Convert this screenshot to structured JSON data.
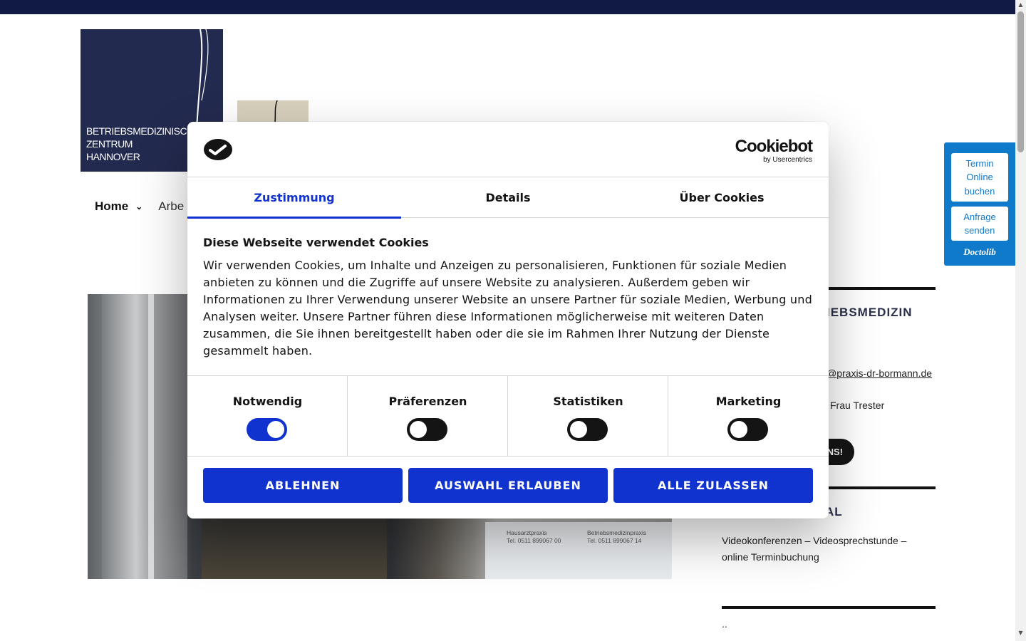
{
  "logo": {
    "lines": [
      "BETRIEBSMEDIZINISCHES",
      "ZENTRUM",
      "HANNOVER"
    ]
  },
  "nav": {
    "home_label": "Home",
    "second_label_partial": "Arbe"
  },
  "hero": {
    "sign_left": [
      "Hausarztpraxis",
      "Tel. 0511 899067 00"
    ],
    "sign_right": [
      "Betriebsmedizinpraxis",
      "Tel. 0511 899067 14"
    ]
  },
  "sidebar": {
    "section1_heading_visible": "IEBSMEDIZIN",
    "email_visible": "@praxis-dr-bormann.de",
    "contact_visible": "Frau Trester",
    "button_visible": "NS!",
    "section2_heading_visible": "AL",
    "section2_text": "Videokonferenzen – Videosprechstunde – online Terminbuchung",
    "section3_text": ".."
  },
  "doctolib": {
    "book_label": "Termin Online buchen",
    "request_label": "Anfrage senden",
    "brand": "Doctolib"
  },
  "cookie_dialog": {
    "brand_name": "Cookiebot",
    "brand_by": "by Usercentrics",
    "tabs": [
      {
        "label": "Zustimmung",
        "active": true
      },
      {
        "label": "Details",
        "active": false
      },
      {
        "label": "Über Cookies",
        "active": false
      }
    ],
    "title": "Diese Webseite verwendet Cookies",
    "body": "Wir verwenden Cookies, um Inhalte und Anzeigen zu personalisieren, Funktionen für soziale Medien anbieten zu können und die Zugriffe auf unsere Website zu analysieren. Außerdem geben wir Informationen zu Ihrer Verwendung unserer Website an unsere Partner für soziale Medien, Werbung und Analysen weiter. Unsere Partner führen diese Informationen möglicherweise mit weiteren Daten zusammen, die Sie ihnen bereitgestellt haben oder die sie im Rahmen Ihrer Nutzung der Dienste gesammelt haben.",
    "categories": [
      {
        "label": "Notwendig",
        "enabled": true
      },
      {
        "label": "Präferenzen",
        "enabled": false
      },
      {
        "label": "Statistiken",
        "enabled": false
      },
      {
        "label": "Marketing",
        "enabled": false
      }
    ],
    "buttons": {
      "decline": "ABLEHNEN",
      "allow_selection": "AUSWAHL ERLAUBEN",
      "allow_all": "ALLE ZULASSEN"
    }
  },
  "colors": {
    "accent": "#1032cf",
    "top_bar": "#111a44",
    "logo_bg": "#232a4f",
    "doctolib": "#107aca"
  }
}
